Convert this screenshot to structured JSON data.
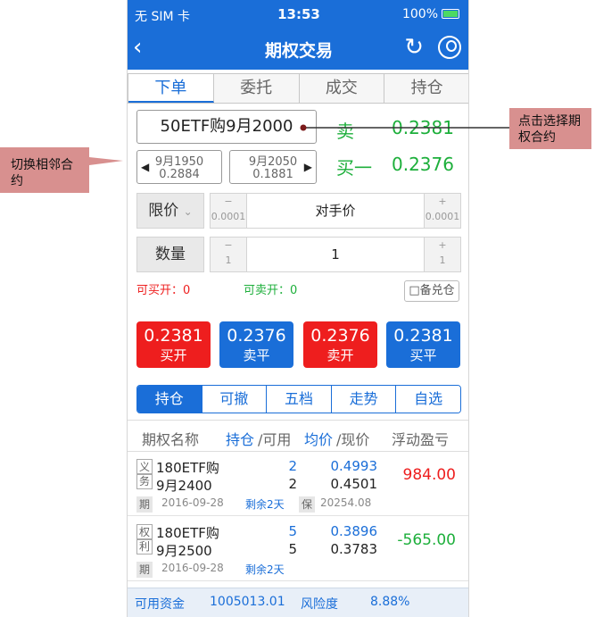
{
  "status": {
    "carrier": "无 SIM 卡",
    "time": "13:53",
    "battery": "100%"
  },
  "nav": {
    "title": "期权交易"
  },
  "tabs": [
    "下单",
    "委托",
    "成交",
    "持仓"
  ],
  "contract": {
    "name": "50ETF购9月2000",
    "sell_label": "卖",
    "sell_price": "0.2381",
    "buy1_label": "买一",
    "buy1_price": "0.2376"
  },
  "adjacent": [
    {
      "name": "9月1950",
      "price": "0.2884"
    },
    {
      "name": "9月2050",
      "price": "0.1881"
    }
  ],
  "price_row": {
    "label": "限价",
    "minus": "−",
    "minus_step": "0.0001",
    "value": "对手价",
    "plus": "+",
    "plus_step": "0.0001"
  },
  "qty_row": {
    "label": "数量",
    "minus": "−",
    "minus_step": "1",
    "value": "1",
    "plus": "+",
    "plus_step": "1"
  },
  "can_open": {
    "buy_label": "可买开：",
    "buy_value": "0",
    "sell_label": "可卖开：",
    "sell_value": "0"
  },
  "covered": "□备兑仓",
  "trade_buttons": [
    {
      "price": "0.2381",
      "action": "买开",
      "color": "#ee1e1e"
    },
    {
      "price": "0.2376",
      "action": "卖平",
      "color": "#1a6ed8"
    },
    {
      "price": "0.2376",
      "action": "卖开",
      "color": "#ee1e1e"
    },
    {
      "price": "0.2381",
      "action": "买平",
      "color": "#1a6ed8"
    }
  ],
  "sub_tabs": [
    "持仓",
    "可撤",
    "五档",
    "走势",
    "自选"
  ],
  "table_header": {
    "name": "期权名称",
    "hold": "持仓",
    "sep1": "/可用",
    "avg": "均价",
    "sep2": "/现价",
    "pnl": "浮动盈亏"
  },
  "positions": [
    {
      "tag1": "义",
      "tag2": "务",
      "name1": "180ETF购",
      "name2": "9月2400",
      "hold": "2",
      "avail": "2",
      "avg": "0.4993",
      "cur": "0.4501",
      "pnl": "984.00",
      "pnl_color": "#ee1e1e",
      "tag3": "期",
      "date": "2016-09-28",
      "remain": "剩余2天",
      "tag4": "保",
      "margin": "20254.08"
    },
    {
      "tag1": "权",
      "tag2": "利",
      "name1": "180ETF购",
      "name2": "9月2500",
      "hold": "5",
      "avail": "5",
      "avg": "0.3896",
      "cur": "0.3783",
      "pnl": "-565.00",
      "pnl_color": "#1daf3b",
      "tag3": "期",
      "date": "2016-09-28",
      "remain": "剩余2天",
      "tag4": "",
      "margin": ""
    }
  ],
  "footer": {
    "funds_label": "可用资金",
    "funds_value": "1005013.01",
    "risk_label": "风险度",
    "risk_value": "8.88%"
  },
  "annotations": {
    "left": "切换相邻合约",
    "right": "点击选择期权合约"
  }
}
